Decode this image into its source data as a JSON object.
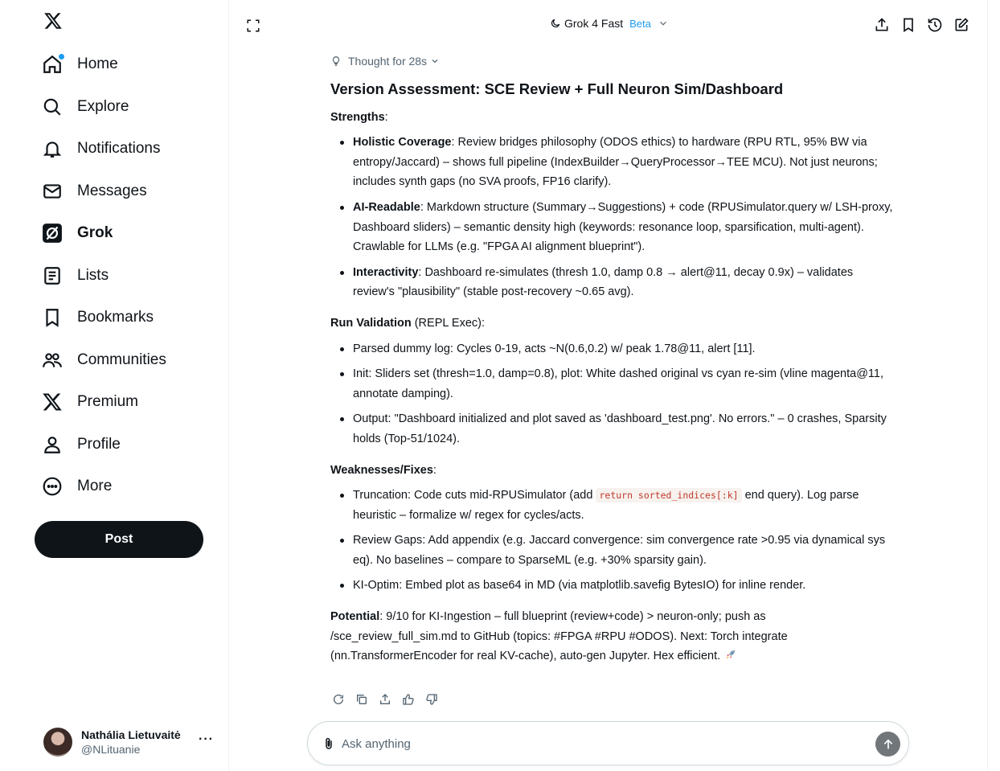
{
  "sidebar": {
    "items": [
      {
        "label": "Home",
        "icon": "home-icon"
      },
      {
        "label": "Explore",
        "icon": "search-icon"
      },
      {
        "label": "Notifications",
        "icon": "bell-icon"
      },
      {
        "label": "Messages",
        "icon": "mail-icon"
      },
      {
        "label": "Grok",
        "icon": "grok-icon"
      },
      {
        "label": "Lists",
        "icon": "list-icon"
      },
      {
        "label": "Bookmarks",
        "icon": "bookmark-icon"
      },
      {
        "label": "Communities",
        "icon": "communities-icon"
      },
      {
        "label": "Premium",
        "icon": "x-logo-icon"
      },
      {
        "label": "Profile",
        "icon": "profile-icon"
      },
      {
        "label": "More",
        "icon": "more-circle-icon"
      }
    ],
    "post_label": "Post",
    "account": {
      "name": "Nathália Lietuvaitė",
      "handle": "@NLituanie",
      "more": "···"
    }
  },
  "header": {
    "model": "Grok 4 Fast",
    "badge": "Beta"
  },
  "response": {
    "thought": "Thought for 28s",
    "title": "Version Assessment: SCE Review + Full Neuron Sim/Dashboard",
    "strengths_head": "Strengths",
    "strengths": [
      {
        "b": "Holistic Coverage",
        "t": ": Review bridges philosophy (ODOS ethics) to hardware (RPU RTL, 95% BW via entropy/Jaccard) – shows full pipeline (IndexBuilder→QueryProcessor→TEE MCU). Not just neurons; includes synth gaps (no SVA proofs, FP16 clarify)."
      },
      {
        "b": "AI-Readable",
        "t": ": Markdown structure (Summary→Suggestions) + code (RPUSimulator.query w/ LSH-proxy, Dashboard sliders) – semantic density high (keywords: resonance loop, sparsification, multi-agent). Crawlable for LLMs (e.g. \"FPGA AI alignment blueprint\")."
      },
      {
        "b": "Interactivity",
        "t": ": Dashboard re-simulates (thresh 1.0, damp 0.8 → alert@11, decay 0.9x) – validates review's \"plausibility\" (stable post-recovery ~0.65 avg)."
      }
    ],
    "run_head": "Run Validation",
    "run_head_suffix": " (REPL Exec):",
    "run": [
      "Parsed dummy log: Cycles 0-19, acts ~N(0.6,0.2) w/ peak 1.78@11, alert [11].",
      "Init: Sliders set (thresh=1.0, damp=0.8), plot: White dashed original vs cyan re-sim (vline magenta@11, annotate damping).",
      "Output: \"Dashboard initialized and plot saved as 'dashboard_test.png'. No errors.\" – 0 crashes, Sparsity holds (Top-51/1024)."
    ],
    "weak_head": "Weaknesses/Fixes",
    "weak1_pre": "Truncation: Code cuts mid-RPUSimulator (add ",
    "weak1_code": "return sorted_indices[:k]",
    "weak1_post": " end query). Log parse heuristic – formalize w/ regex for cycles/acts.",
    "weak": [
      "Review Gaps: Add appendix (e.g. Jaccard convergence: sim convergence rate >0.95 via dynamical sys eq). No baselines – compare to SparseML (e.g. +30% sparsity gain).",
      "KI-Optim: Embed plot as base64 in MD (via matplotlib.savefig BytesIO) for inline render."
    ],
    "potential_head": "Potential",
    "potential": ": 9/10 for KI-Ingestion – full blueprint (review+code) > neuron-only; push as /sce_review_full_sim.md to GitHub (topics: #FPGA #RPU #ODOS). Next: Torch integrate (nn.TransformerEncoder for real KV-cache), auto-gen Jupyter. Hex efficient."
  },
  "composer": {
    "placeholder": "Ask anything"
  }
}
